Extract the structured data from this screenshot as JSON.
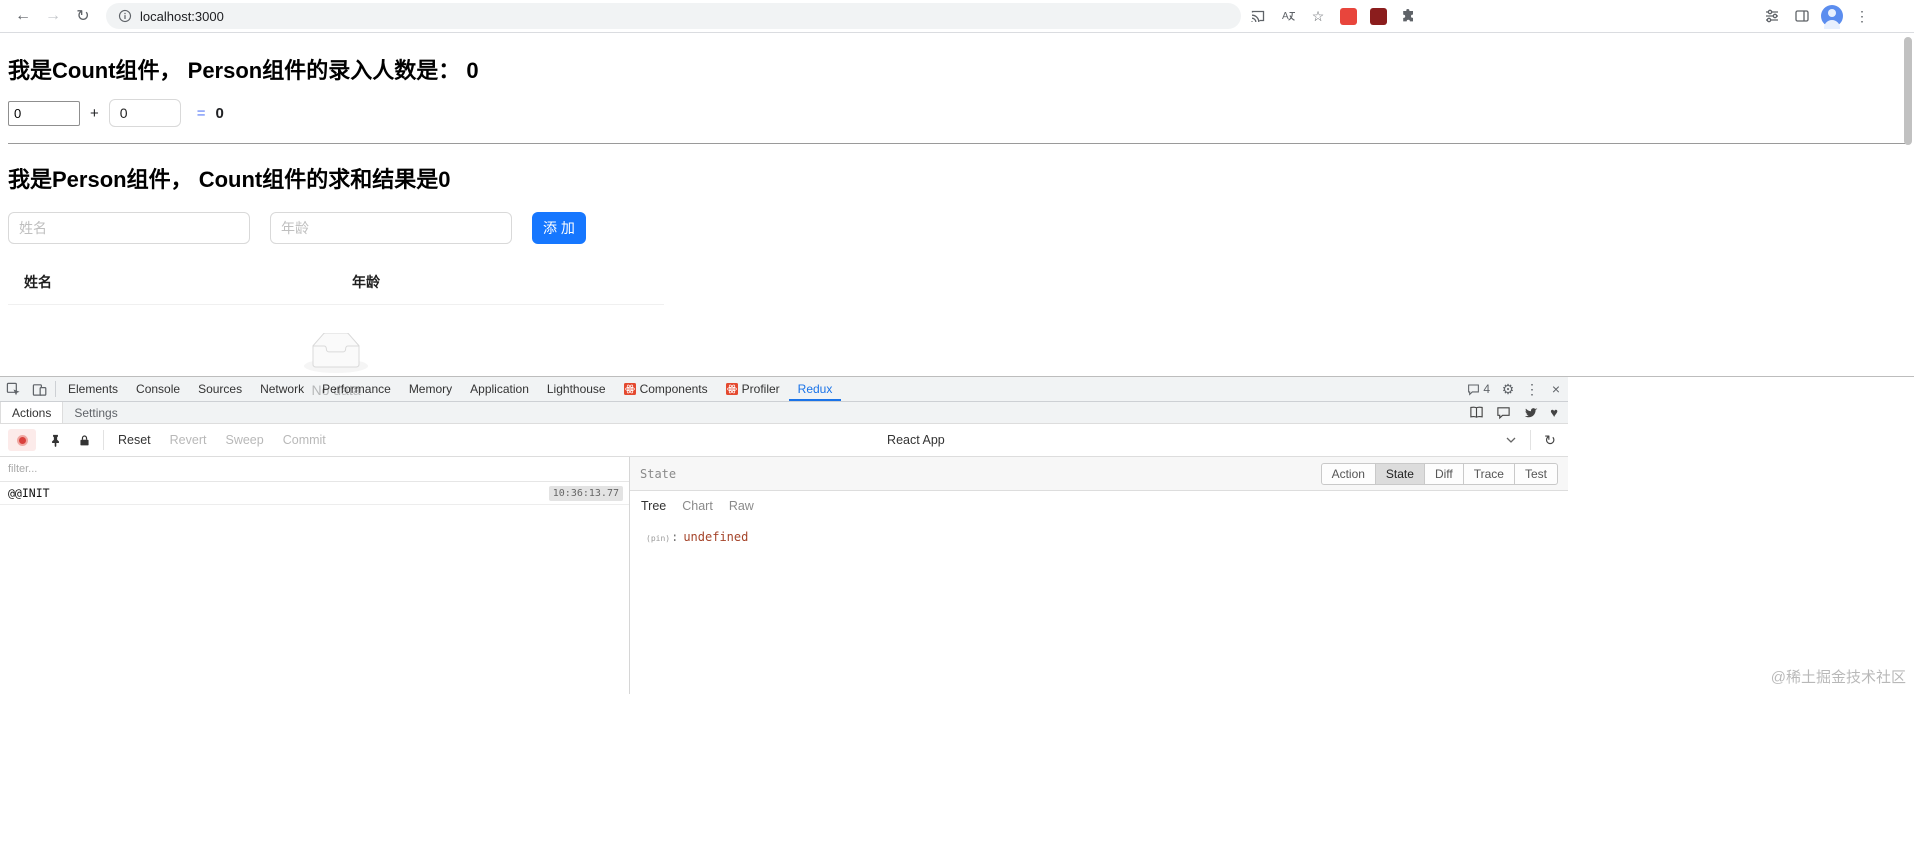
{
  "browser": {
    "url": "localhost:3000"
  },
  "icons": {
    "back": "←",
    "forward": "→",
    "reload": "↻",
    "star": "☆",
    "kebab": "⋮",
    "gear": "⚙",
    "close": "×",
    "heart": "♥",
    "refresh": "↻"
  },
  "page": {
    "count_heading": "我是Count组件， Person组件的录入人数是： 0",
    "sum_row": {
      "num1": "0",
      "plus": "+",
      "num2": "0",
      "equals": "=",
      "result": "0"
    },
    "person_heading": "我是Person组件， Count组件的求和结果是0",
    "form": {
      "name_placeholder": "姓名",
      "age_placeholder": "年龄",
      "add_label": "添 加"
    },
    "table": {
      "col_name": "姓名",
      "col_age": "年龄",
      "empty_text": "No data"
    }
  },
  "devtools": {
    "tabs": [
      "Elements",
      "Console",
      "Sources",
      "Network",
      "Performance",
      "Memory",
      "Application",
      "Lighthouse",
      "Components",
      "Profiler",
      "Redux"
    ],
    "selected_tab": "Redux",
    "issues_count": "4",
    "panel_tabs": {
      "actions": "Actions",
      "settings": "Settings"
    },
    "toolbar": {
      "reset": "Reset",
      "revert": "Revert",
      "sweep": "Sweep",
      "commit": "Commit",
      "instance": "React App"
    },
    "filter_placeholder": "filter...",
    "action_item": {
      "name": "@@INIT",
      "time": "10:36:13.77"
    },
    "inspector": {
      "title": "State",
      "tabs": [
        "Action",
        "State",
        "Diff",
        "Trace",
        "Test"
      ],
      "selected_tab": "State",
      "view_tabs": [
        "Tree",
        "Chart",
        "Raw"
      ],
      "selected_view": "Tree",
      "pin_label": "(pin)",
      "colon": ":",
      "value": "undefined"
    }
  },
  "watermark": "@稀土掘金技术社区",
  "colors": {
    "primary_button": "#1677ff",
    "devtools_accent": "#1a73e8",
    "record_red": "#d9413d",
    "undefined_value": "#a5442a",
    "equals_text": "#5b7cf7"
  }
}
